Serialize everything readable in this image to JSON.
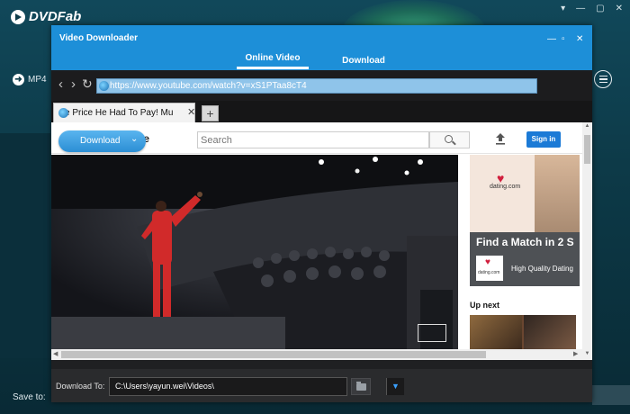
{
  "background_app": {
    "logo": "DVDFab",
    "window_controls": [
      "▾",
      "—",
      "▢",
      "✕"
    ],
    "format_label": "MP4",
    "save_to_label": "Save to:"
  },
  "dialog": {
    "title": "Video Downloader",
    "title_controls": {
      "minimize": "—",
      "maximize": "▫",
      "close": "✕"
    },
    "tabs": [
      {
        "label": "Online Video",
        "active": true
      },
      {
        "label": "Download",
        "active": false
      }
    ],
    "nav": {
      "back": "‹",
      "forward": "›",
      "reload": "↻"
    },
    "url": "https://www.youtube.com/watch?v=xS1PTaa8cT4",
    "browser_tab": {
      "label": "e Price He Had To Pay! Mu",
      "close": "✕"
    },
    "new_tab": "+",
    "page": {
      "logo_fragment": "be",
      "search_placeholder": "Search",
      "sign_in": "Sign in",
      "download_button": "Download",
      "ad": {
        "brand": "dating.com",
        "headline": "Find a Match in 2 S",
        "logo_text": "dating.com",
        "tagline": "High Quality Dating"
      },
      "up_next": "Up next"
    },
    "download_to": {
      "label": "Download To:",
      "path": "C:\\Users\\yayun.wei\\Videos\\"
    }
  },
  "colors": {
    "accent_blue": "#1d8fd8",
    "url_highlight": "#8fc4ea",
    "dialog_bg": "#1f2022",
    "sign_in_blue": "#1b7ad6"
  }
}
